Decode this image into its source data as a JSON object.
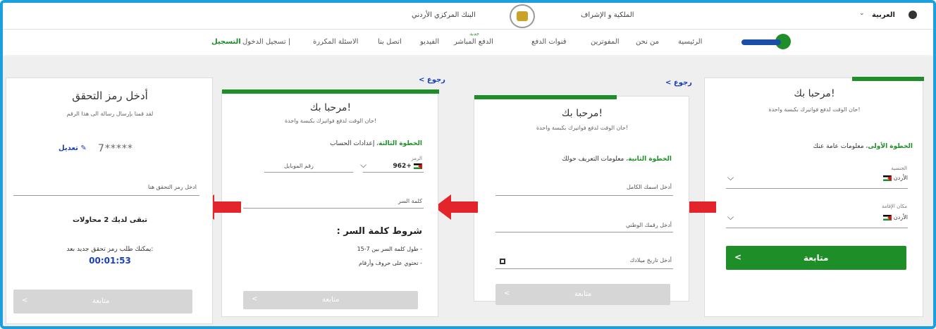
{
  "topbar": {
    "language": "العربية",
    "supervision": "الملكية و الإشراف",
    "central_bank": "البنك المركزي الأردني"
  },
  "nav": {
    "items": [
      {
        "label": "الرئيسية"
      },
      {
        "label": "من نحن"
      },
      {
        "label": "المفوترين"
      },
      {
        "label": "قنوات الدفع"
      },
      {
        "label": "الدفع المباشر"
      },
      {
        "label": "الفيديو"
      },
      {
        "label": "اتصل بنا"
      },
      {
        "label": "الاسئلة المكررة"
      }
    ],
    "login": "تسجيل الدخول |",
    "register": "التسجيل",
    "new_badge": "جديد"
  },
  "card1": {
    "title": "مرحبا بك!",
    "subtitle": "حان الوقت لدفع فواتيرك بكبسة واحدة!",
    "step_bold": "الخطوة الأولى",
    "step_text": "، معلومات عامة عنك",
    "nationality_label": "الجنسية",
    "nationality_value": "الأردن",
    "residence_label": "مكان الإقامة",
    "residence_value": "الأردن",
    "continue": "متابعة",
    "continue_arrow": "<"
  },
  "card2": {
    "back": "< رجوع",
    "title": "مرحبا بك!",
    "subtitle": "حان الوقت لدفع فواتيرك بكبسة واحدة!",
    "step_bold": "الخطوة الثانية",
    "step_text": "، معلومات التعريف حولك",
    "fullname_placeholder": "أدخل اسمك الكامل",
    "national_placeholder": "أدخل رقمك الوطني",
    "birth_placeholder": "أدخل تاريخ ميلادك",
    "continue": "متابعة",
    "continue_arrow": "<"
  },
  "card3": {
    "back": "< رجوع",
    "title": "مرحبا بك!",
    "subtitle": "حان الوقت لدفع فواتيرك بكبسة واحدة!",
    "step_bold": "الخطوة الثالثة",
    "step_text": "، إعدادات الحساب",
    "code_label": "الرمز",
    "code_value": "962+",
    "mobile_placeholder": "رقم الموبايل",
    "password_placeholder": "كلمة السر",
    "pw_title": "شروط كلمة السر :",
    "pw_rule1": "- طول كلمة السر بين 7-15",
    "pw_rule2": "- تحتوي على حروف وأرقام",
    "continue": "متابعة",
    "continue_arrow": "<"
  },
  "card4": {
    "title": "أدخل رمز التحقق",
    "subtitle": "لقد قمنا بإرسال رسالة الى هذا الرقم",
    "masked_number": "7*****",
    "edit": "تعديل",
    "code_placeholder": "ادخل رمز التحقق هنا",
    "attempts": "تبقى لديك 2 محاولات",
    "resend": "يمكنك طلب رمز تحقق جديد بعد:",
    "timer": "00:01:53",
    "continue": "متابعة",
    "continue_arrow": "<"
  },
  "colors": {
    "brand_green": "#1e8e28",
    "arrow_red": "#e3242b",
    "frame_blue": "#1e9fdd",
    "link_blue": "#1a3fb8"
  }
}
